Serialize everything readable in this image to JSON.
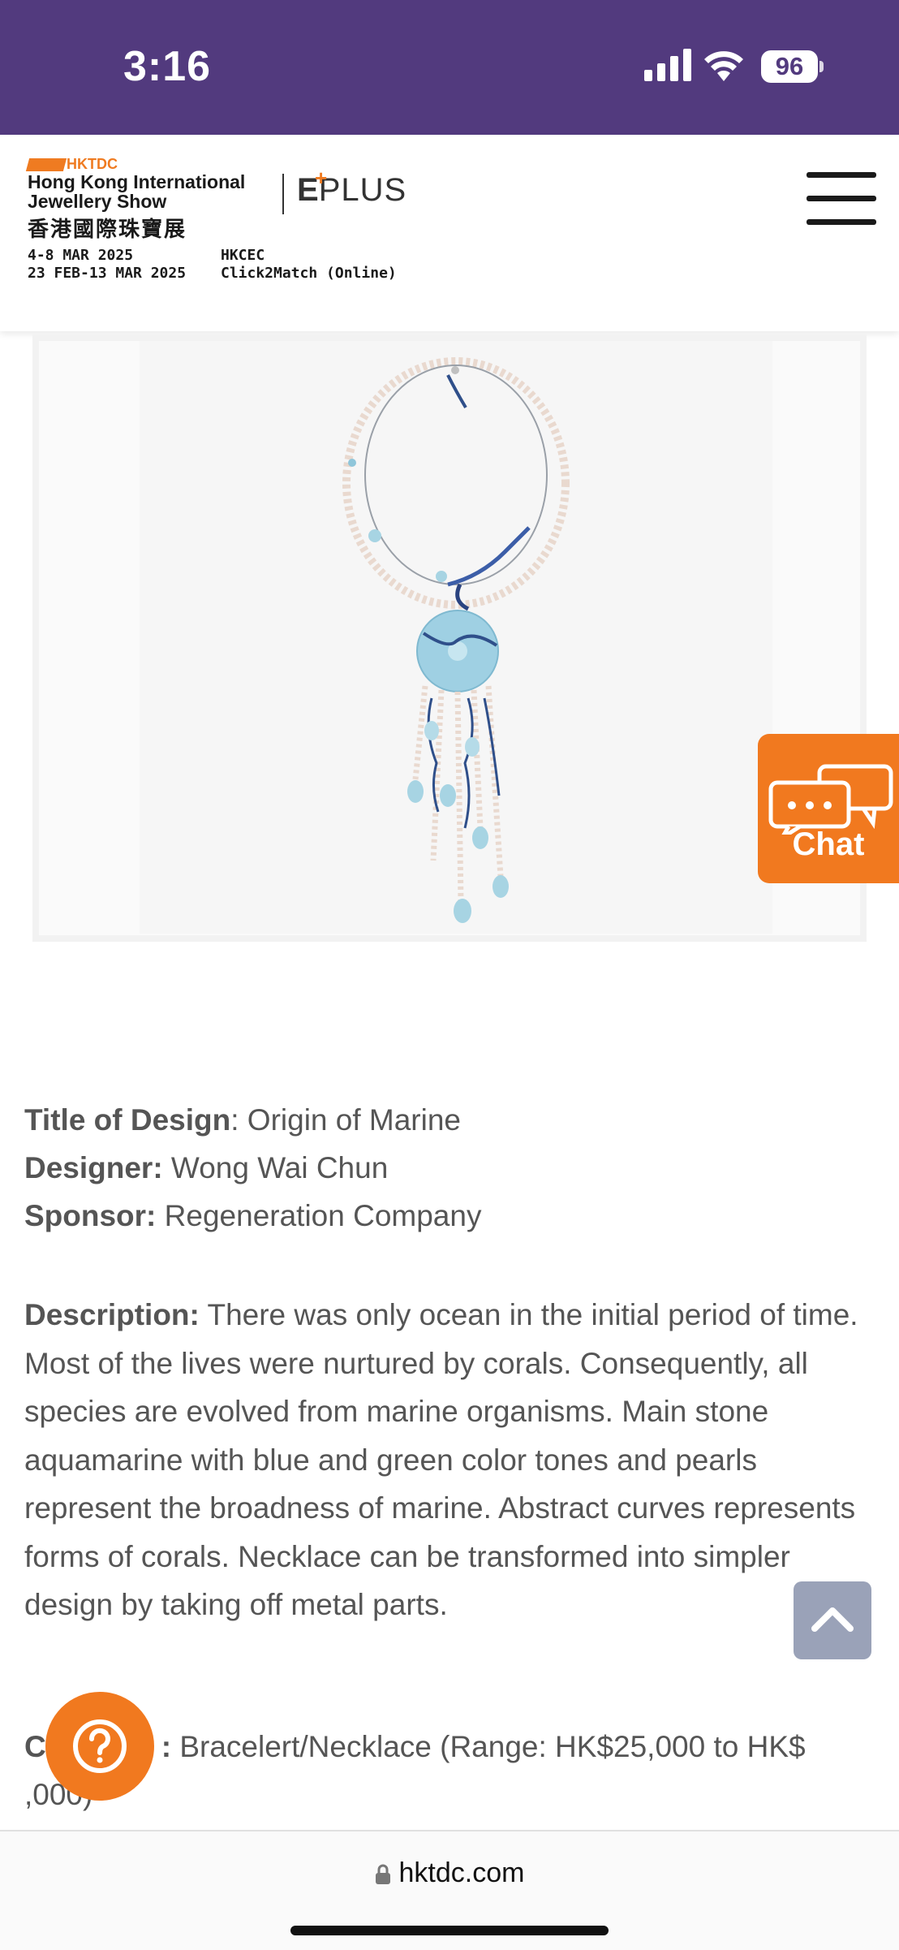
{
  "status_bar": {
    "time": "3:16",
    "battery": "96",
    "background": "#523a7e"
  },
  "header": {
    "org_logo_text": "HKTDC",
    "show_name_line1": "Hong Kong International",
    "show_name_line2": "Jewellery Show",
    "show_name_cn": "香港國際珠寶展",
    "eplus_logo": "EPLUS",
    "dates_line1": "4-8 MAR 2025",
    "dates_line2": "23 FEB-13 MAR 2025",
    "venue_line1": "HKCEC",
    "venue_line2": "Click2Match (Online)",
    "menu_icon": "hamburger-icon"
  },
  "chat": {
    "label": "Chat",
    "icon": "chat-bubbles-icon",
    "color": "#f1791f"
  },
  "details": {
    "title_label": "Title of Design",
    "title_value": ": Origin of Marine",
    "designer_label": "Designer:",
    "designer_value": " Wong Wai Chun",
    "sponsor_label": "Sponsor:",
    "sponsor_value": " Regeneration Company",
    "description_label": "Description:",
    "description_value": " There was only ocean in the initial period of time. Most of the lives were nurtured by corals. Consequently, all species are evolved from marine organisms. Main stone aquamarine with blue and green color tones and pearls represent the broadness of marine. Abstract curves represents forms of corals. Necklace can be transformed into simpler design by taking off metal parts.",
    "category_label": "C",
    "category_label_end": ":",
    "category_value": " Bracelert/Necklace (Range: HK$25,000 to HK$",
    "category_value_end": ",000)"
  },
  "floating": {
    "back_to_top_icon": "chevron-up-icon",
    "help_icon": "question-icon"
  },
  "browser": {
    "url": "hktdc.com"
  }
}
